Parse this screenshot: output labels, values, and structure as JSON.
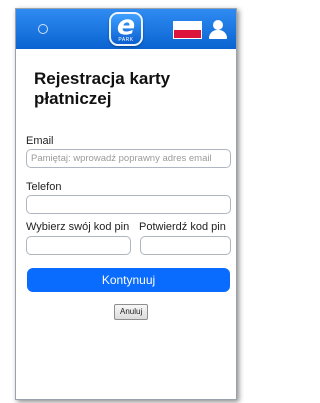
{
  "header": {
    "logo_text": "e",
    "logo_subtext": "PARK",
    "flag": "poland-flag-icon",
    "user_icon": "user-icon",
    "back_icon": "back-icon",
    "bar_color": "#0a63d1"
  },
  "form": {
    "title": "Rejestracja karty płatniczej",
    "email_label": "Email",
    "email_placeholder": "Pamiętaj: wprowadź poprawny adres email",
    "phone_label": "Telefon",
    "pin_label": "Wybierz swój kod pin",
    "pin_confirm_label": "Potwierdź kod pin",
    "continue_label": "Kontynuuj",
    "cancel_label": "Anuluj",
    "accent_color": "#0a6bff"
  }
}
